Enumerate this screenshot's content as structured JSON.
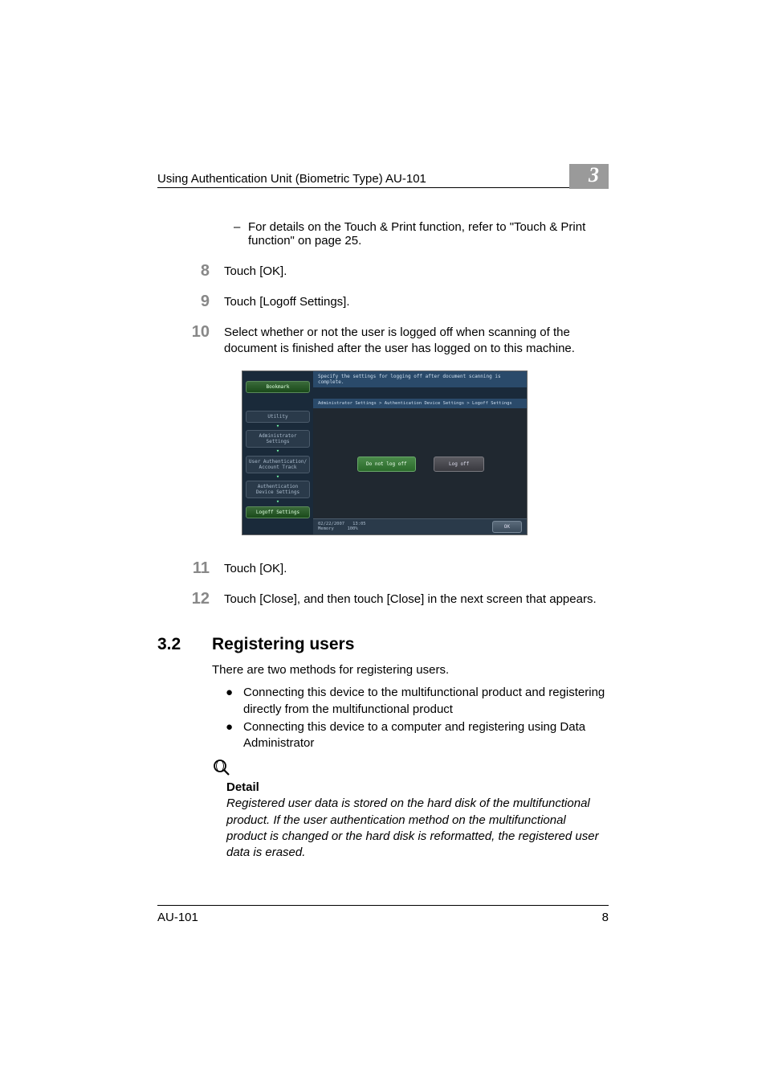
{
  "header": {
    "title": "Using Authentication Unit (Biometric Type) AU-101",
    "chapter": "3"
  },
  "note_dash": {
    "text": "For details on the Touch & Print function, refer to \"Touch & Print function\" on page 25."
  },
  "steps": {
    "s8": {
      "num": "8",
      "text": "Touch [OK]."
    },
    "s9": {
      "num": "9",
      "text": "Touch [Logoff Settings]."
    },
    "s10": {
      "num": "10",
      "text": "Select whether or not the user is logged off when scanning of the document is finished after the user has logged on to this machine."
    },
    "s11": {
      "num": "11",
      "text": "Touch [OK]."
    },
    "s12": {
      "num": "12",
      "text": "Touch [Close], and then touch [Close] in the next screen that appears."
    }
  },
  "mfp": {
    "bookmark": "Bookmark",
    "utility": "Utility",
    "admin": "Administrator Settings",
    "userauth": "User Authentication/ Account Track",
    "authdev": "Authentication Device Settings",
    "logoff": "Logoff Settings",
    "topbar": "Specify the settings for logging off after document scanning is complete.",
    "breadcrumb": "Administrator Settings > Authentication Device Settings > Logoff Settings",
    "btn_do_not": "Do not log off",
    "btn_log_off": "Log off",
    "date": "02/22/2007",
    "time": "13:05",
    "memory": "Memory",
    "mempct": "100%",
    "ok": "OK"
  },
  "section": {
    "num": "3.2",
    "title": "Registering users",
    "intro": "There are two methods for registering users.",
    "bullet1": "Connecting this device to the multifunctional product and registering directly from the multifunctional product",
    "bullet2": "Connecting this device to a computer and registering using Data Administrator"
  },
  "detail": {
    "label": "Detail",
    "text": "Registered user data is stored on the hard disk of the multifunctional product. If the user authentication method on the multifunctional product is changed or the hard disk is reformatted, the registered user data is erased."
  },
  "footer": {
    "model": "AU-101",
    "page": "8"
  }
}
